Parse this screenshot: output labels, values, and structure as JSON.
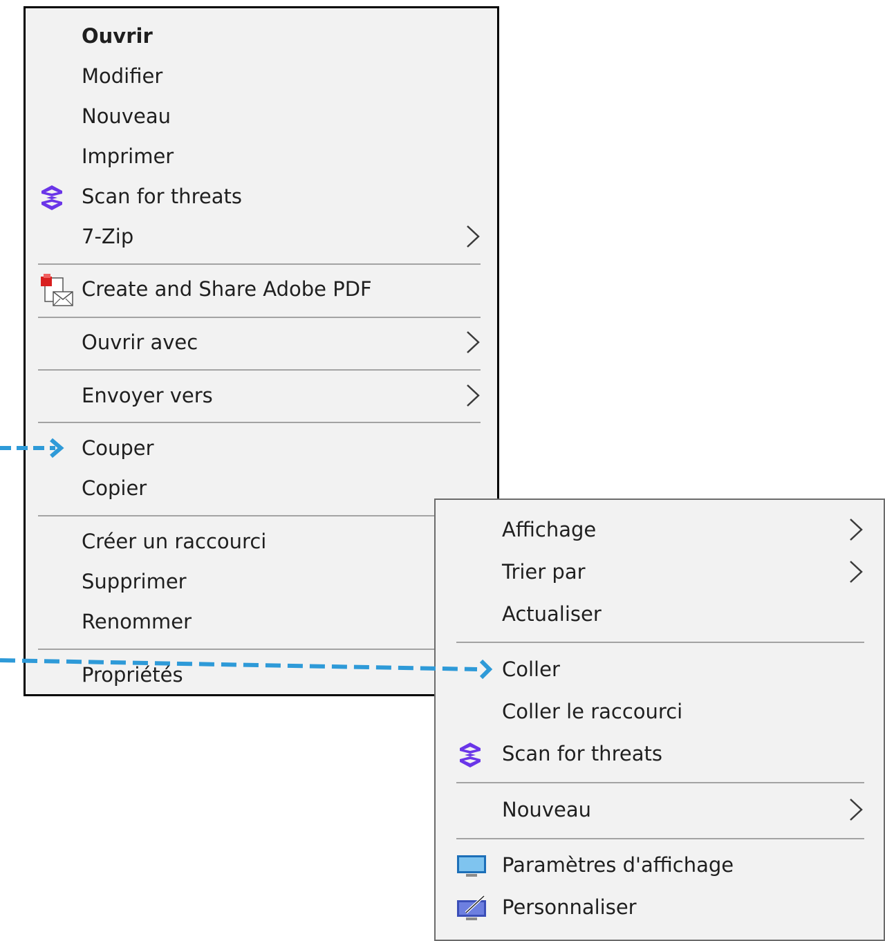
{
  "file_menu": {
    "items": [
      {
        "label": "Ouvrir"
      },
      {
        "label": "Modifier"
      },
      {
        "label": "Nouveau"
      },
      {
        "label": "Imprimer"
      },
      {
        "label": "Scan for threats",
        "icon": "shield-scan-icon"
      },
      {
        "label": "7-Zip"
      },
      {
        "label": "Create and Share Adobe PDF",
        "icon": "adobe-pdf-icon"
      },
      {
        "label": "Ouvrir avec"
      },
      {
        "label": "Envoyer vers"
      },
      {
        "label": "Couper"
      },
      {
        "label": "Copier"
      },
      {
        "label": "Créer un raccourci"
      },
      {
        "label": "Supprimer"
      },
      {
        "label": "Renommer"
      },
      {
        "label": "Propriétés"
      }
    ]
  },
  "desktop_menu": {
    "items": [
      {
        "label": "Affichage"
      },
      {
        "label": "Trier par"
      },
      {
        "label": "Actualiser"
      },
      {
        "label": "Coller"
      },
      {
        "label": "Coller le raccourci"
      },
      {
        "label": "Scan for threats",
        "icon": "shield-scan-icon"
      },
      {
        "label": "Nouveau"
      },
      {
        "label": "Paramètres d'affichage",
        "icon": "display-settings-icon"
      },
      {
        "label": "Personnaliser",
        "icon": "personalize-icon"
      }
    ]
  },
  "colors": {
    "arrow": "#2e9ad8",
    "scan_icon": "#6a35e8",
    "menu_bg": "#f2f2f2",
    "separator": "#a3a3a3"
  }
}
